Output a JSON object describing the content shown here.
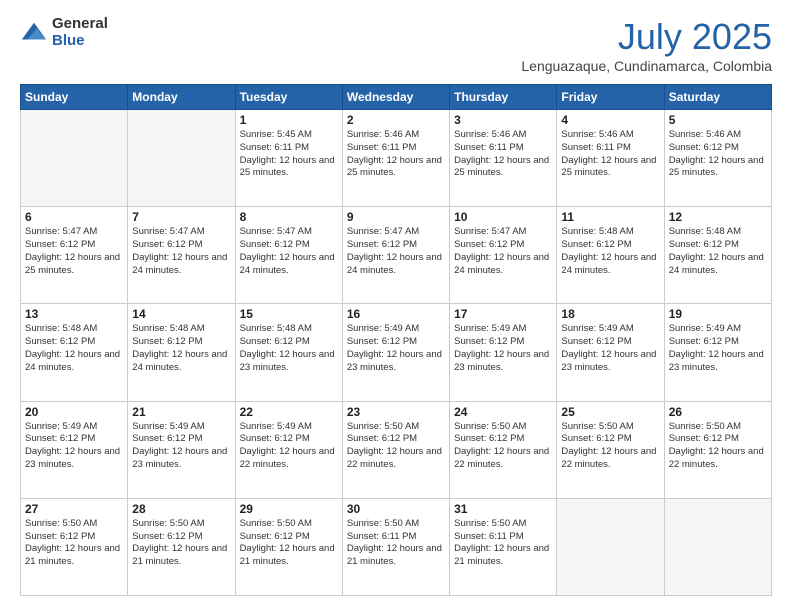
{
  "logo": {
    "general": "General",
    "blue": "Blue"
  },
  "title": "July 2025",
  "location": "Lenguazaque, Cundinamarca, Colombia",
  "days_of_week": [
    "Sunday",
    "Monday",
    "Tuesday",
    "Wednesday",
    "Thursday",
    "Friday",
    "Saturday"
  ],
  "weeks": [
    [
      {
        "day": "",
        "info": ""
      },
      {
        "day": "",
        "info": ""
      },
      {
        "day": "1",
        "info": "Sunrise: 5:45 AM\nSunset: 6:11 PM\nDaylight: 12 hours and 25 minutes."
      },
      {
        "day": "2",
        "info": "Sunrise: 5:46 AM\nSunset: 6:11 PM\nDaylight: 12 hours and 25 minutes."
      },
      {
        "day": "3",
        "info": "Sunrise: 5:46 AM\nSunset: 6:11 PM\nDaylight: 12 hours and 25 minutes."
      },
      {
        "day": "4",
        "info": "Sunrise: 5:46 AM\nSunset: 6:11 PM\nDaylight: 12 hours and 25 minutes."
      },
      {
        "day": "5",
        "info": "Sunrise: 5:46 AM\nSunset: 6:12 PM\nDaylight: 12 hours and 25 minutes."
      }
    ],
    [
      {
        "day": "6",
        "info": "Sunrise: 5:47 AM\nSunset: 6:12 PM\nDaylight: 12 hours and 25 minutes."
      },
      {
        "day": "7",
        "info": "Sunrise: 5:47 AM\nSunset: 6:12 PM\nDaylight: 12 hours and 24 minutes."
      },
      {
        "day": "8",
        "info": "Sunrise: 5:47 AM\nSunset: 6:12 PM\nDaylight: 12 hours and 24 minutes."
      },
      {
        "day": "9",
        "info": "Sunrise: 5:47 AM\nSunset: 6:12 PM\nDaylight: 12 hours and 24 minutes."
      },
      {
        "day": "10",
        "info": "Sunrise: 5:47 AM\nSunset: 6:12 PM\nDaylight: 12 hours and 24 minutes."
      },
      {
        "day": "11",
        "info": "Sunrise: 5:48 AM\nSunset: 6:12 PM\nDaylight: 12 hours and 24 minutes."
      },
      {
        "day": "12",
        "info": "Sunrise: 5:48 AM\nSunset: 6:12 PM\nDaylight: 12 hours and 24 minutes."
      }
    ],
    [
      {
        "day": "13",
        "info": "Sunrise: 5:48 AM\nSunset: 6:12 PM\nDaylight: 12 hours and 24 minutes."
      },
      {
        "day": "14",
        "info": "Sunrise: 5:48 AM\nSunset: 6:12 PM\nDaylight: 12 hours and 24 minutes."
      },
      {
        "day": "15",
        "info": "Sunrise: 5:48 AM\nSunset: 6:12 PM\nDaylight: 12 hours and 23 minutes."
      },
      {
        "day": "16",
        "info": "Sunrise: 5:49 AM\nSunset: 6:12 PM\nDaylight: 12 hours and 23 minutes."
      },
      {
        "day": "17",
        "info": "Sunrise: 5:49 AM\nSunset: 6:12 PM\nDaylight: 12 hours and 23 minutes."
      },
      {
        "day": "18",
        "info": "Sunrise: 5:49 AM\nSunset: 6:12 PM\nDaylight: 12 hours and 23 minutes."
      },
      {
        "day": "19",
        "info": "Sunrise: 5:49 AM\nSunset: 6:12 PM\nDaylight: 12 hours and 23 minutes."
      }
    ],
    [
      {
        "day": "20",
        "info": "Sunrise: 5:49 AM\nSunset: 6:12 PM\nDaylight: 12 hours and 23 minutes."
      },
      {
        "day": "21",
        "info": "Sunrise: 5:49 AM\nSunset: 6:12 PM\nDaylight: 12 hours and 23 minutes."
      },
      {
        "day": "22",
        "info": "Sunrise: 5:49 AM\nSunset: 6:12 PM\nDaylight: 12 hours and 22 minutes."
      },
      {
        "day": "23",
        "info": "Sunrise: 5:50 AM\nSunset: 6:12 PM\nDaylight: 12 hours and 22 minutes."
      },
      {
        "day": "24",
        "info": "Sunrise: 5:50 AM\nSunset: 6:12 PM\nDaylight: 12 hours and 22 minutes."
      },
      {
        "day": "25",
        "info": "Sunrise: 5:50 AM\nSunset: 6:12 PM\nDaylight: 12 hours and 22 minutes."
      },
      {
        "day": "26",
        "info": "Sunrise: 5:50 AM\nSunset: 6:12 PM\nDaylight: 12 hours and 22 minutes."
      }
    ],
    [
      {
        "day": "27",
        "info": "Sunrise: 5:50 AM\nSunset: 6:12 PM\nDaylight: 12 hours and 21 minutes."
      },
      {
        "day": "28",
        "info": "Sunrise: 5:50 AM\nSunset: 6:12 PM\nDaylight: 12 hours and 21 minutes."
      },
      {
        "day": "29",
        "info": "Sunrise: 5:50 AM\nSunset: 6:12 PM\nDaylight: 12 hours and 21 minutes."
      },
      {
        "day": "30",
        "info": "Sunrise: 5:50 AM\nSunset: 6:11 PM\nDaylight: 12 hours and 21 minutes."
      },
      {
        "day": "31",
        "info": "Sunrise: 5:50 AM\nSunset: 6:11 PM\nDaylight: 12 hours and 21 minutes."
      },
      {
        "day": "",
        "info": ""
      },
      {
        "day": "",
        "info": ""
      }
    ]
  ]
}
